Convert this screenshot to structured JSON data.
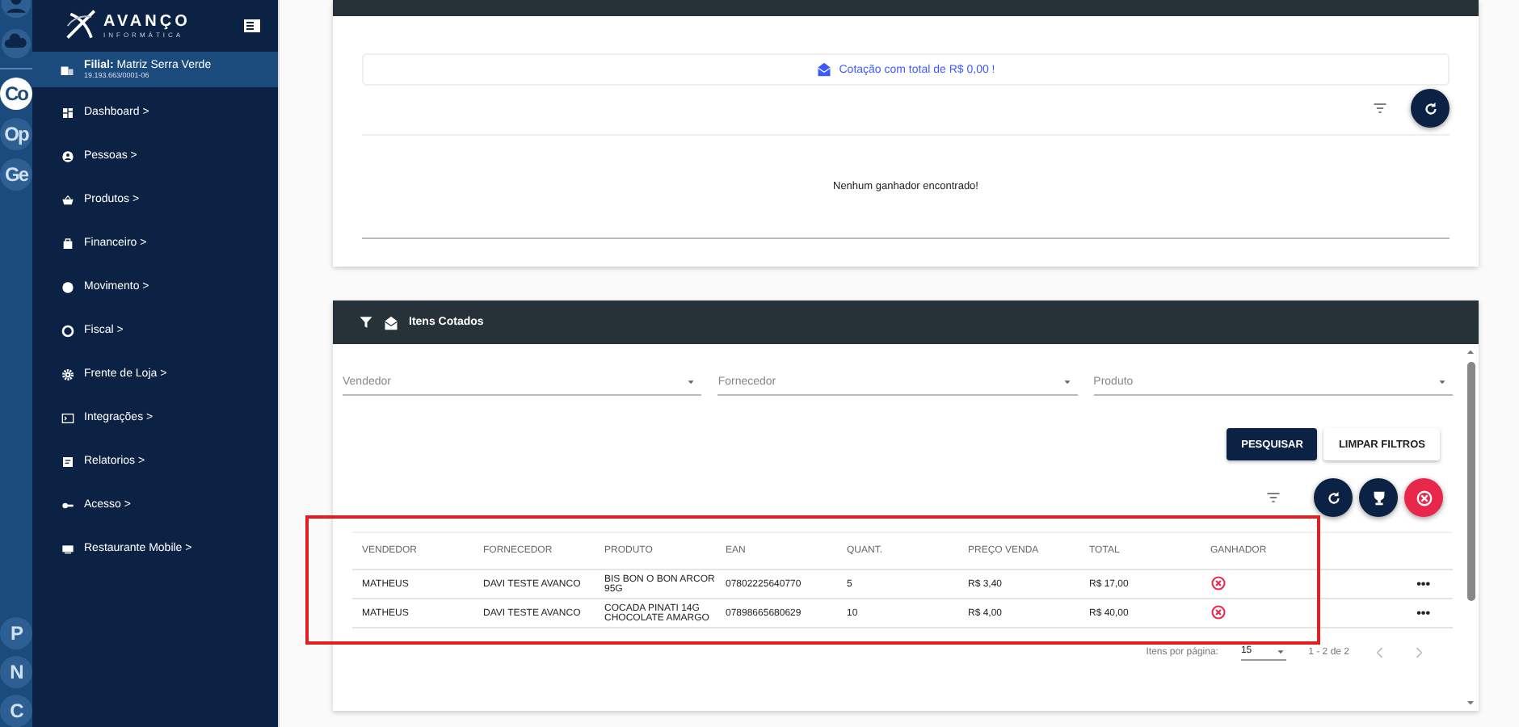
{
  "rail": {
    "items": [
      {
        "kind": "icon",
        "selected": false
      },
      {
        "kind": "icon",
        "selected": false
      },
      {
        "kind": "text",
        "label": "Co",
        "selected": true
      },
      {
        "kind": "text",
        "label": "Op",
        "selected": false
      },
      {
        "kind": "text",
        "label": "Ge",
        "selected": false
      }
    ],
    "bottom": [
      "P",
      "N",
      "C"
    ]
  },
  "sidebar": {
    "logo": {
      "name": "AVANÇO",
      "tagline": "INFORMÁTICA"
    },
    "branch": {
      "label": "Filial:",
      "name": "Matriz Serra Verde",
      "cnpj": "19.193.663/0001-06"
    },
    "items": [
      {
        "label": "Dashboard >"
      },
      {
        "label": "Pessoas >"
      },
      {
        "label": "Produtos >"
      },
      {
        "label": "Financeiro >"
      },
      {
        "label": "Movimento >"
      },
      {
        "label": "Fiscal >"
      },
      {
        "label": "Frente de Loja >"
      },
      {
        "label": "Integrações >"
      },
      {
        "label": "Relatorios >"
      },
      {
        "label": "Acesso >"
      },
      {
        "label": "Restaurante Mobile >"
      }
    ]
  },
  "winners": {
    "notice": "Cotação com total de R$ 0,00 !",
    "empty": "Nenhum ganhador encontrado!"
  },
  "items_panel": {
    "title": "Itens Cotados",
    "filters": [
      {
        "placeholder": "Vendedor"
      },
      {
        "placeholder": "Fornecedor"
      },
      {
        "placeholder": "Produto"
      }
    ],
    "buttons": [
      {
        "label": "PESQUISAR",
        "kind": "primary"
      },
      {
        "label": "LIMPAR FILTROS",
        "kind": "secondary"
      }
    ],
    "table": {
      "columns": [
        "VENDEDOR",
        "FORNECEDOR",
        "PRODUTO",
        "EAN",
        "QUANT.",
        "PREÇO VENDA",
        "TOTAL",
        "GANHADOR"
      ],
      "rows": [
        {
          "cells": [
            "MATHEUS",
            "DAVI TESTE AVANCO",
            "BIS BON O BON ARCOR 95G",
            "07802225640770",
            "5",
            "R$ 3,40",
            "R$ 17,00"
          ],
          "winner": false,
          "menu": "•••"
        },
        {
          "cells": [
            "MATHEUS",
            "DAVI TESTE AVANCO",
            "COCADA PINATI 14G CHOCOLATE AMARGO",
            "07898665680629",
            "10",
            "R$ 4,00",
            "R$ 40,00"
          ],
          "winner": false,
          "menu": "•••"
        }
      ]
    },
    "paginator": {
      "label": "Itens por página:",
      "page_size": "15",
      "range": "1 - 2 de 2"
    }
  },
  "annotation": {
    "kind": "highlight-box"
  }
}
